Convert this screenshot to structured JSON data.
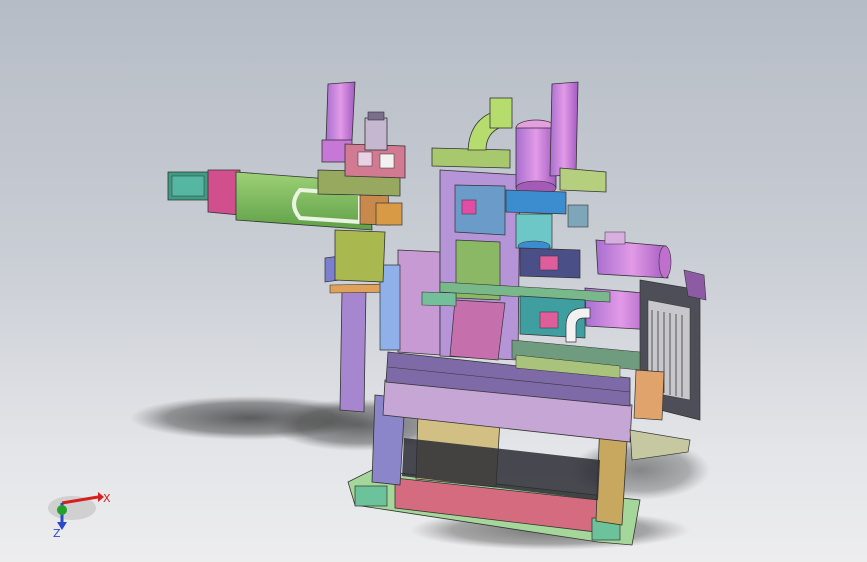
{
  "viewport": {
    "background_top": "#b6bcc6",
    "background_bottom": "#ededee"
  },
  "triad": {
    "x_label": "X",
    "y_label": "Y",
    "z_label": "Z",
    "x_color": "#d62020",
    "y_color": "#22a22a",
    "z_color": "#2b48c8"
  }
}
